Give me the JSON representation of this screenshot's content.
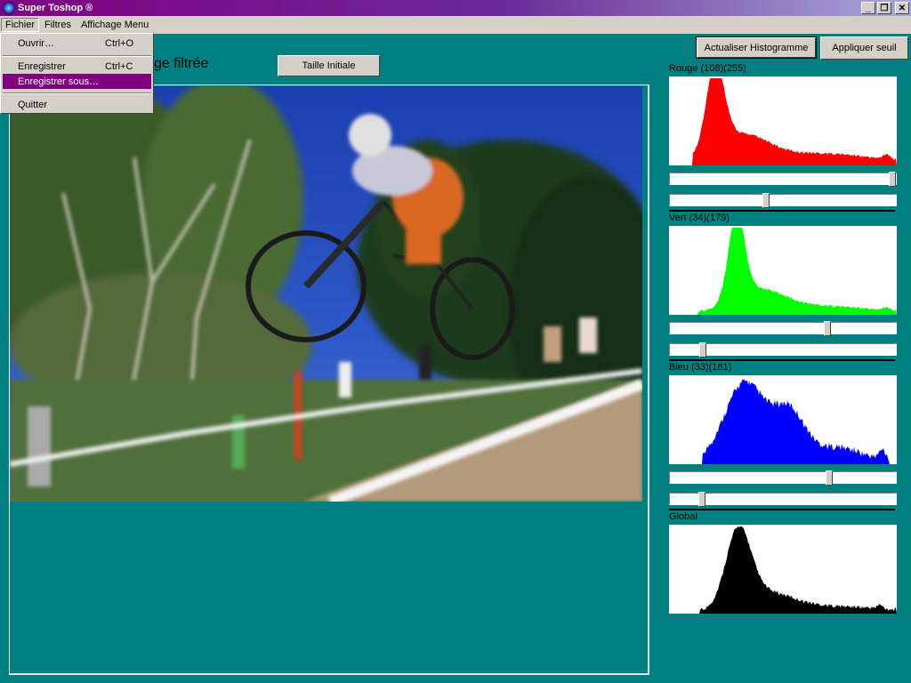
{
  "window": {
    "title": "Super Toshop ®",
    "minimize": "_",
    "restore": "❐",
    "close": "✕"
  },
  "menubar": {
    "items": [
      "Fichier",
      "Filtres",
      "Affichage Menu"
    ]
  },
  "fichier_menu": {
    "ouvrir": {
      "label": "Ouvrir…",
      "shortcut": "Ctrl+O"
    },
    "enregistrer": {
      "label": "Enregistrer",
      "shortcut": "Ctrl+C"
    },
    "enregistrer_sous": {
      "label": "Enregistrer sous…"
    },
    "quitter": {
      "label": "Quitter"
    }
  },
  "main": {
    "heading_visible": "ge filtrée",
    "taille_button": "Taille Initiale"
  },
  "toolbar": {
    "actualiser": "Actualiser Histogramme",
    "appliquer": "Appliquer seuil"
  },
  "histograms": {
    "rouge": {
      "label": "Rouge (108)(255)",
      "color": "#ff0000",
      "slider_top": 1.0,
      "slider_bottom": 0.424
    },
    "vert": {
      "label": "Vert (34)(179)",
      "color": "#00ff00",
      "slider_top": 0.702,
      "slider_bottom": 0.133
    },
    "bleu": {
      "label": "Bleu (33)(181)",
      "color": "#0000ff",
      "slider_top": 0.71,
      "slider_bottom": 0.129
    },
    "global": {
      "label": "Global",
      "color": "#000000"
    }
  }
}
